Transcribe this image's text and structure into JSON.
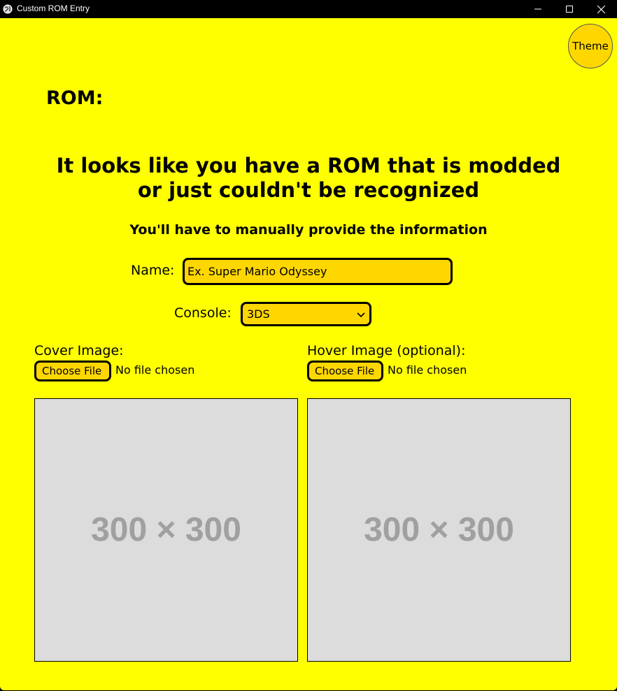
{
  "window": {
    "title": "Custom ROM Entry"
  },
  "icons": {
    "app": "globe-icon",
    "minimize": "minimize-icon",
    "maximize": "maximize-icon",
    "close": "close-icon"
  },
  "colors": {
    "background": "#ffff00",
    "accent": "#ffd700",
    "placeholder_bg": "#dcdcdc",
    "placeholder_text": "#a0a0a0"
  },
  "theme_button": {
    "label": "Theme"
  },
  "rom": {
    "label": "ROM:"
  },
  "message": {
    "headline": "It looks like you have a ROM that is modded or just couldn't be recognized",
    "subheadline": "You'll have to manually provide the information"
  },
  "form": {
    "name_label": "Name:",
    "name_placeholder": "Ex. Super Mario Odyssey",
    "console_label": "Console:",
    "console_selected": "3DS"
  },
  "cover": {
    "label": "Cover Image:",
    "button_label": "Choose File",
    "status": "No file chosen",
    "preview_text": "300 × 300"
  },
  "hover": {
    "label": "Hover Image (optional):",
    "button_label": "Choose File",
    "status": "No file chosen",
    "preview_text": "300 × 300"
  }
}
